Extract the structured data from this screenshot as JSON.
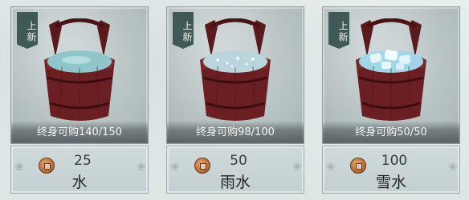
{
  "items": [
    {
      "tag": "上新",
      "icon": "water-bucket-icon",
      "limit": "终身可购140/150",
      "price": "25",
      "currency_icon": "copper-coin-icon",
      "name": "水",
      "water_color": "#8fc6cc"
    },
    {
      "tag": "上新",
      "icon": "rain-water-bucket-icon",
      "limit": "终身可购98/100",
      "price": "50",
      "currency_icon": "copper-coin-icon",
      "name": "雨水",
      "water_color": "#b9d6dc"
    },
    {
      "tag": "上新",
      "icon": "snow-water-bucket-icon",
      "limit": "终身可购50/50",
      "price": "100",
      "currency_icon": "copper-coin-icon",
      "name": "雪水",
      "water_color": "#9fd6ea"
    }
  ],
  "colors": {
    "bucket_wood": "#6b1f22",
    "bucket_wood_dark": "#4a1216",
    "tag_bg": "#3f5a56"
  }
}
